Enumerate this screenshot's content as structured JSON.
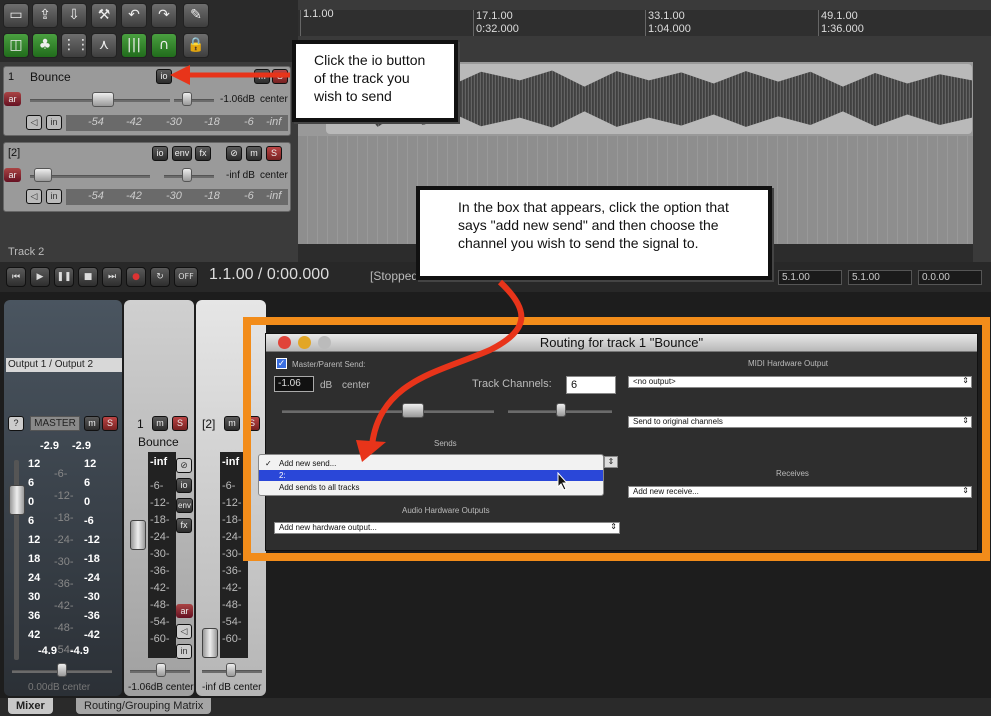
{
  "arrange": {
    "ruler_marks": [
      {
        "bar": "1.1.00",
        "time": ""
      },
      {
        "bar": "17.1.00",
        "time": "0:32.000"
      },
      {
        "bar": "33.1.00",
        "time": "1:04.000"
      },
      {
        "bar": "49.1.00",
        "time": "1:36.000"
      }
    ]
  },
  "tracks": [
    {
      "num": "1",
      "name": "Bounce",
      "volume": "-1.06dB",
      "pan": "center",
      "meter": [
        "-54",
        "-42",
        "-30",
        "-18",
        "-6",
        "-inf"
      ],
      "btn_ar": "ar",
      "btn_in": "in",
      "btn_io": "io",
      "btn_env": "env",
      "btn_fx": "fx",
      "btn_m": "m",
      "btn_s": "S"
    },
    {
      "num": "[2]",
      "name": "",
      "volume": "-inf dB",
      "pan": "center",
      "meter": [
        "-54",
        "-42",
        "-30",
        "-18",
        "-6",
        "-inf"
      ],
      "btn_ar": "ar",
      "btn_in": "in",
      "btn_io": "io",
      "btn_env": "env",
      "btn_fx": "fx",
      "btn_m": "m",
      "btn_s": "S"
    }
  ],
  "track_status": "Track 2",
  "transport": {
    "time": "1.1.00 / 0:00.000",
    "state": "[Stopped",
    "off_label": "OFF",
    "field1": "5.1.00",
    "field2": "5.1.00",
    "field3": "0.0.00"
  },
  "mixer": {
    "master": {
      "output": "Output 1 / Output 2",
      "label": "MASTER",
      "peak_l": "-2.9",
      "peak_r": "-2.9",
      "scale_left": [
        "12",
        "6",
        "0",
        "6",
        "12",
        "18",
        "24",
        "30",
        "36",
        "42"
      ],
      "scale_mid": [
        "-6-",
        "-12-",
        "-18-",
        "-24-",
        "-30-",
        "-36-",
        "-42-",
        "-48-",
        "-54-"
      ],
      "scale_right": [
        "12",
        "6",
        "0",
        "-6",
        "-12",
        "-18",
        "-24",
        "-30",
        "-36",
        "-42"
      ],
      "bottom_l": "-4.9",
      "bottom_r": "-4.9",
      "volume": "0.00dB center",
      "btn_m": "m",
      "btn_s": "S",
      "btn_help": "?"
    },
    "strip1": {
      "num": "1",
      "name": "Bounce",
      "peak": "-inf",
      "scale": [
        "-6-",
        "-12-",
        "-18-",
        "-24-",
        "-30-",
        "-36-",
        "-42-",
        "-48-",
        "-54-",
        "-60-"
      ],
      "volume": "-1.06dB center",
      "btn_m": "m",
      "btn_s": "S"
    },
    "strip2": {
      "num": "[2]",
      "name": "",
      "peak": "-inf",
      "scale": [
        "-6-",
        "-12-",
        "-18-",
        "-24-",
        "-30-",
        "-36-",
        "-42-",
        "-48-",
        "-54-",
        "-60-"
      ],
      "volume": "-inf dB center",
      "btn_m": "m",
      "btn_s": "S"
    },
    "tabs": [
      "Mixer",
      "Routing/Grouping Matrix"
    ]
  },
  "routing": {
    "title": "Routing for track 1 \"Bounce\"",
    "master_send": "Master/Parent Send:",
    "vol_value": "-1.06",
    "vol_unit": "dB",
    "pan": "center",
    "track_channels_label": "Track Channels:",
    "track_channels_value": "6",
    "sends_header": "Sends",
    "popup_items": [
      "Add new send...",
      "2:",
      "Add sends to all tracks"
    ],
    "popup_check": "✓",
    "audio_hw_header": "Audio Hardware Outputs",
    "audio_hw_combo": "Add new hardware output...",
    "midi_hw_header": "MIDI Hardware Output",
    "midi_combo": "<no output>",
    "midi_channels_combo": "Send to original channels",
    "receives_header": "Receives",
    "receives_combo": "Add new receive..."
  },
  "callouts": {
    "io": "Click the io button of the track you wish to send",
    "box": "In the box that appears, click the option that says \"add new send\" and then choose the channel you wish to send the signal to."
  },
  "colors": {
    "accent_orange": "#f28c1a",
    "arrow_red": "#e8341a",
    "selection_blue": "#2a47d8"
  }
}
